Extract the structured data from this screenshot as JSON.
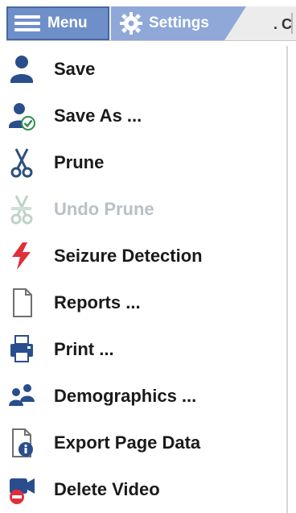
{
  "toolbar": {
    "menu_tab_label": "Menu",
    "settings_tab_label": "Settings",
    "extra_tab_label": ". C"
  },
  "menu": {
    "items": [
      {
        "label": "Save",
        "icon": "save-icon"
      },
      {
        "label": "Save As ...",
        "icon": "save-as-icon"
      },
      {
        "label": "Prune",
        "icon": "scissors-icon"
      },
      {
        "label": "Undo Prune",
        "icon": "undo-prune-icon",
        "disabled": true
      },
      {
        "label": "Seizure Detection",
        "icon": "lightning-icon"
      },
      {
        "label": "Reports ...",
        "icon": "document-icon"
      },
      {
        "label": "Print ...",
        "icon": "printer-icon"
      },
      {
        "label": "Demographics ...",
        "icon": "people-icon"
      },
      {
        "label": "Export Page Data",
        "icon": "export-info-icon"
      },
      {
        "label": "Delete Video",
        "icon": "delete-video-icon"
      }
    ]
  }
}
